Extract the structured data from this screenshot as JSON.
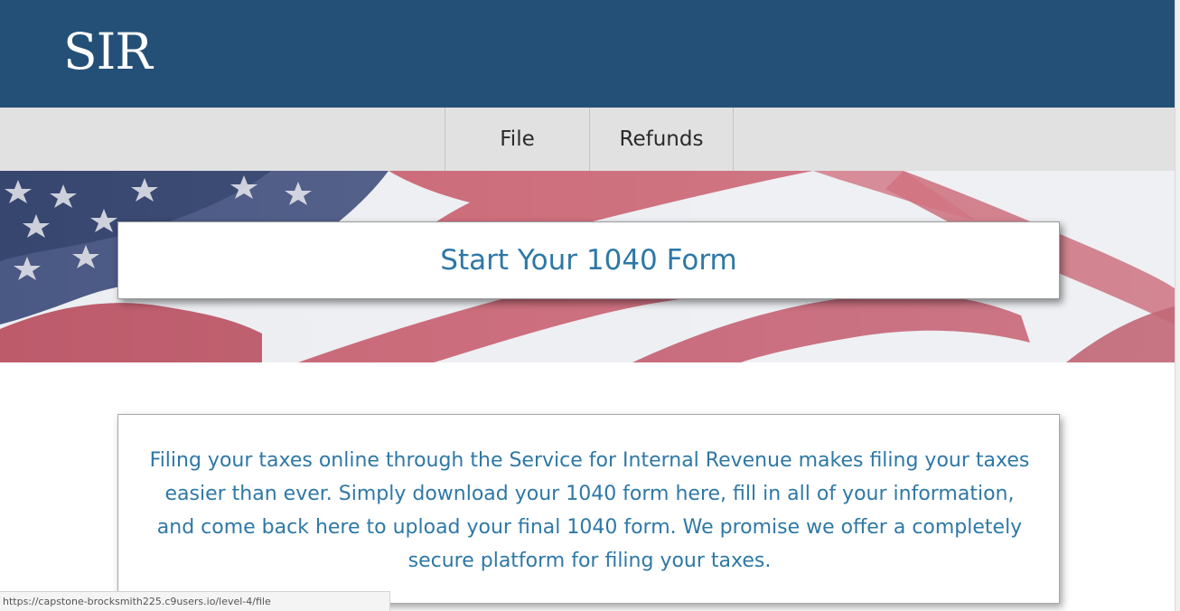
{
  "header": {
    "logo_text": "SIR",
    "background_color": "#245078"
  },
  "nav": {
    "items": [
      {
        "label": "File"
      },
      {
        "label": "Refunds"
      }
    ],
    "background_color": "#e1e1e1"
  },
  "hero": {
    "title": "Start Your 1040 Form",
    "background_image": "american-flag"
  },
  "info": {
    "text": "Filing your taxes online through the Service for Internal Revenue makes filing your taxes easier than ever. Simply download your 1040 form here, fill in all of your information, and come back here to upload your final 1040 form. We promise we offer a completely secure platform for filing your taxes."
  },
  "status_bar": {
    "url": "https://capstone-brocksmith225.c9users.io/level-4/file"
  },
  "colors": {
    "accent_text": "#2e78a6",
    "flag_red": "#c0465a",
    "flag_blue": "#3a4c7a"
  }
}
